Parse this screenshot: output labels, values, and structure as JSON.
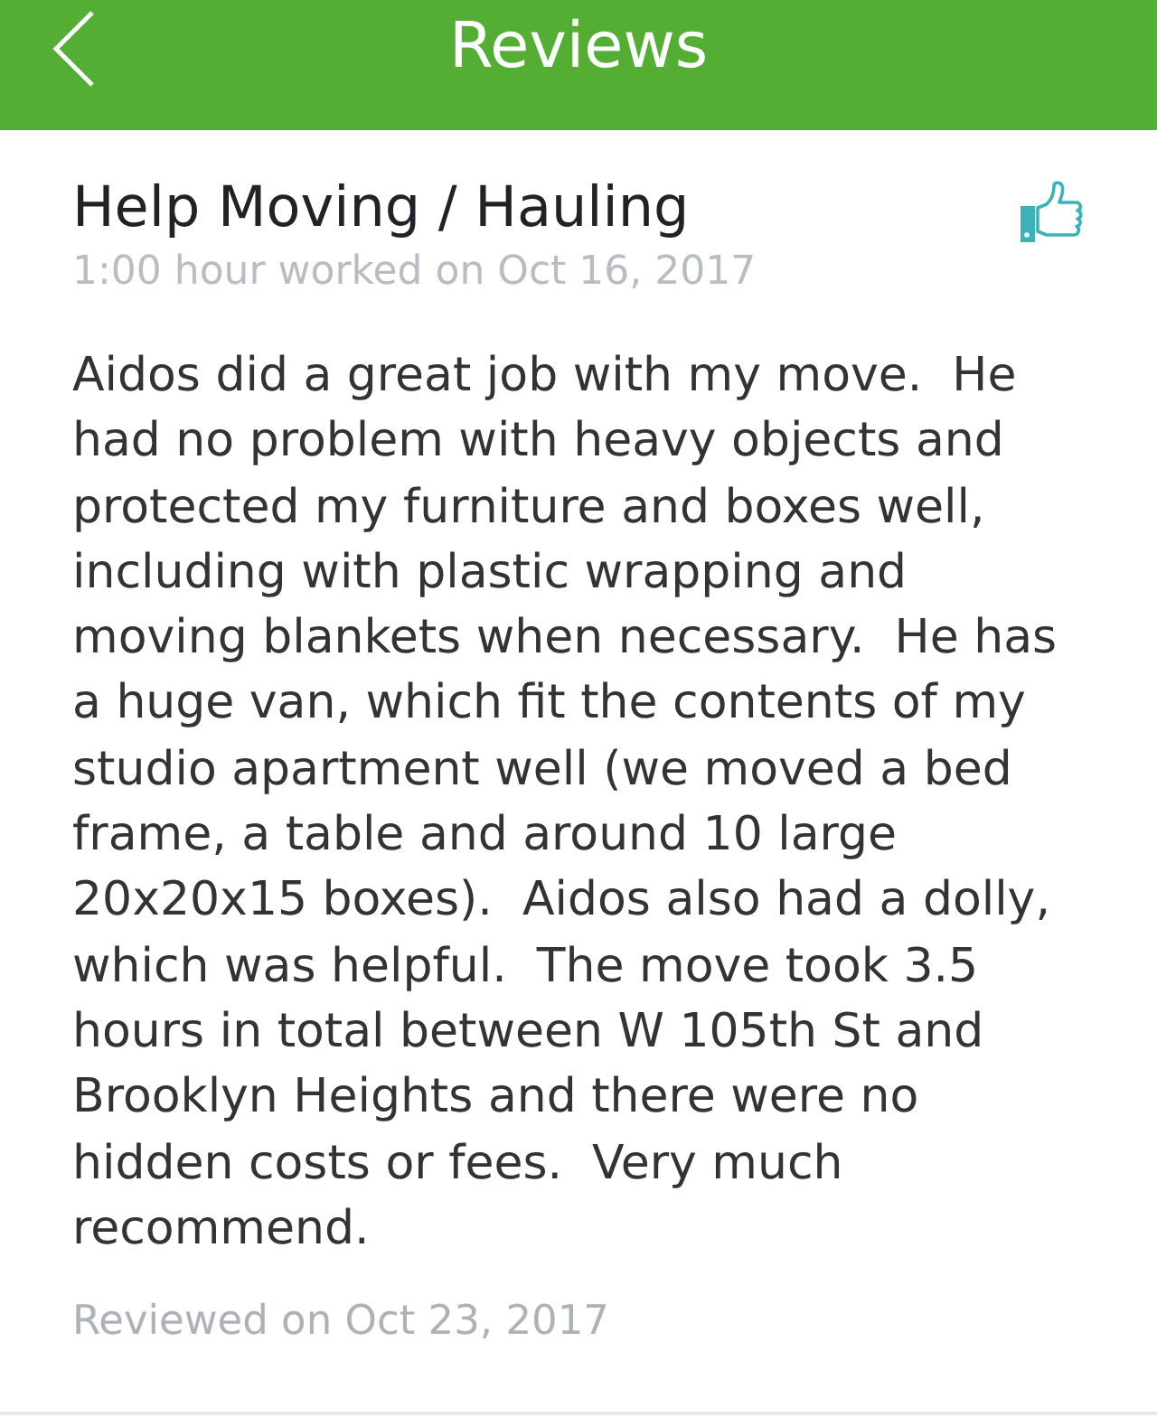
{
  "header": {
    "title": "Reviews"
  },
  "review": {
    "task": "Help Moving / Hauling",
    "worked": "1:00 hour worked on Oct 16, 2017",
    "body": "Aidos did a great job with my move.  He\nhad no problem with heavy objects and\nprotected my furniture and boxes well,\nincluding with plastic wrapping and\nmoving blankets when necessary.  He has\na huge van, which fit the contents of my\nstudio apartment well (we moved a bed\nframe, a table and around 10 large\n20x20x15 boxes).  Aidos also had a dolly,\nwhich was helpful.  The move took 3.5\nhours in total between W 105th St and\nBrooklyn Heights and there were no\nhidden costs or fees.  Very much\nrecommend.",
    "reviewed": "Reviewed on Oct 23, 2017"
  }
}
